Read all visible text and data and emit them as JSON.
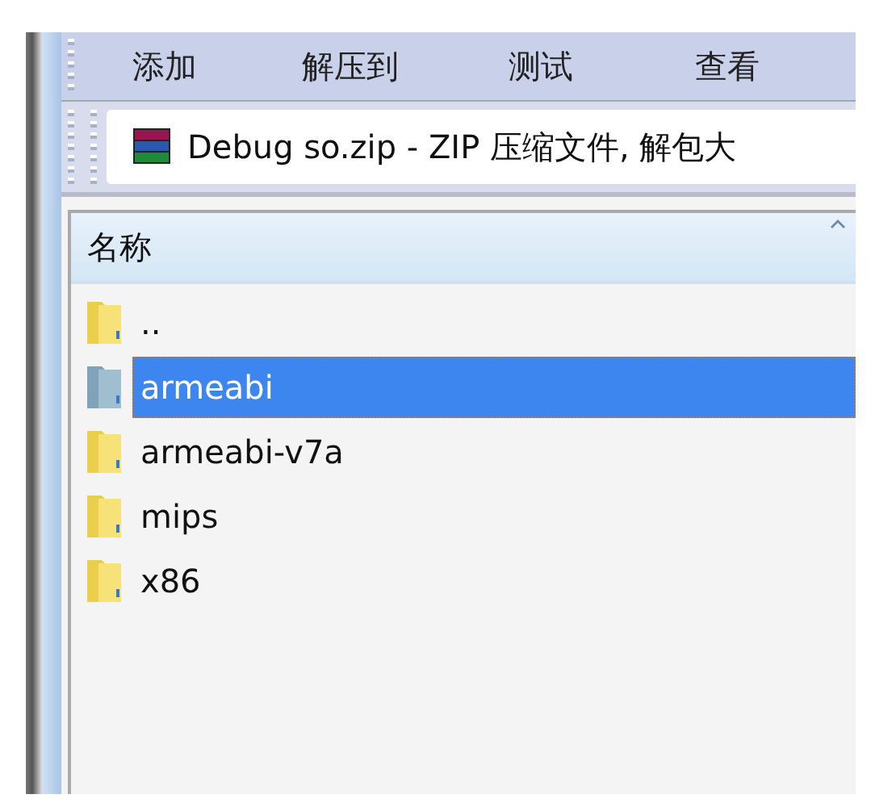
{
  "toolbar": {
    "buttons": [
      {
        "label": "添加"
      },
      {
        "label": "解压到"
      },
      {
        "label": "测试"
      },
      {
        "label": "查看"
      }
    ]
  },
  "address_bar": {
    "text": "Debug so.zip - ZIP 压缩文件, 解包大"
  },
  "file_list": {
    "columns": [
      {
        "label": "名称",
        "sorted": true
      }
    ],
    "rows": [
      {
        "name": "..",
        "selected": false
      },
      {
        "name": "armeabi",
        "selected": true
      },
      {
        "name": "armeabi-v7a",
        "selected": false
      },
      {
        "name": "mips",
        "selected": false
      },
      {
        "name": "x86",
        "selected": false
      }
    ]
  }
}
